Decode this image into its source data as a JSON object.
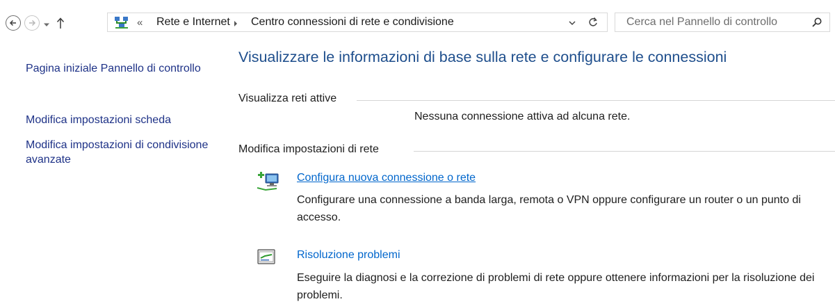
{
  "navbar": {
    "breadcrumb_sep": "«",
    "breadcrumb": [
      "Rete e Internet",
      "Centro connessioni di rete e condivisione"
    ],
    "search_placeholder": "Cerca nel Pannello di controllo"
  },
  "sidebar": {
    "items": [
      {
        "label": "Pagina iniziale Pannello di controllo"
      },
      {
        "label": "Modifica impostazioni scheda"
      },
      {
        "label": "Modifica impostazioni di condivisione avanzate"
      }
    ]
  },
  "main": {
    "title": "Visualizzare le informazioni di base sulla rete e configurare le connessioni",
    "active_networks": {
      "label": "Visualizza reti attive",
      "status": "Nessuna connessione attiva ad alcuna rete."
    },
    "change_settings": {
      "label": "Modifica impostazioni di rete",
      "tasks": [
        {
          "link": "Configura nuova connessione o rete",
          "description": "Configurare una connessione a banda larga, remota o VPN oppure configurare un router o un punto di accesso.",
          "icon": "network-setup-icon"
        },
        {
          "link": "Risoluzione problemi",
          "description": "Eseguire la diagnosi e la correzione di problemi di rete oppure ottenere informazioni per la risoluzione dei problemi.",
          "icon": "troubleshoot-icon"
        }
      ]
    }
  },
  "colors": {
    "title": "#1e4e8c",
    "link": "#0066cc",
    "sidebar_link": "#1e3287"
  }
}
